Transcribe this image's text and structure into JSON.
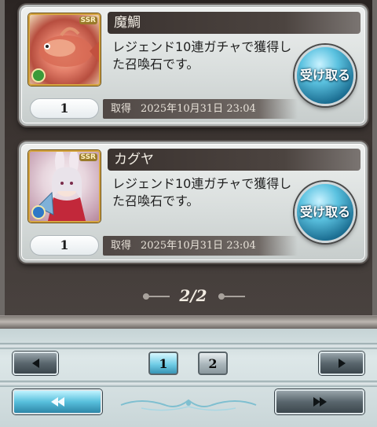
{
  "items": [
    {
      "name": "魔鯛",
      "rarity": "SSR",
      "description": "レジェンド10連ガチャで獲得した召喚石です。",
      "quantity": "1",
      "date_label": "取得",
      "date": "2025年10月31日 23:04",
      "receive_label": "受け取る",
      "element_color": "#3a9a3a"
    },
    {
      "name": "カグヤ",
      "rarity": "SSR",
      "description": "レジェンド10連ガチャで獲得した召喚石です。",
      "quantity": "1",
      "date_label": "取得",
      "date": "2025年10月31日 23:04",
      "receive_label": "受け取る",
      "element_color": "#2e78c7"
    }
  ],
  "pager": {
    "text": "2/2"
  },
  "pagination": {
    "pages": [
      "1",
      "2"
    ],
    "current_page": "1"
  },
  "colors": {
    "accent": "#57bfdc",
    "card_bg": "#d9dedd",
    "frame_bg": "#3b3431"
  },
  "icons": {
    "prev": "triangle-left-icon",
    "next": "triangle-right-icon",
    "first": "double-triangle-left-icon",
    "last": "double-triangle-right-icon"
  }
}
